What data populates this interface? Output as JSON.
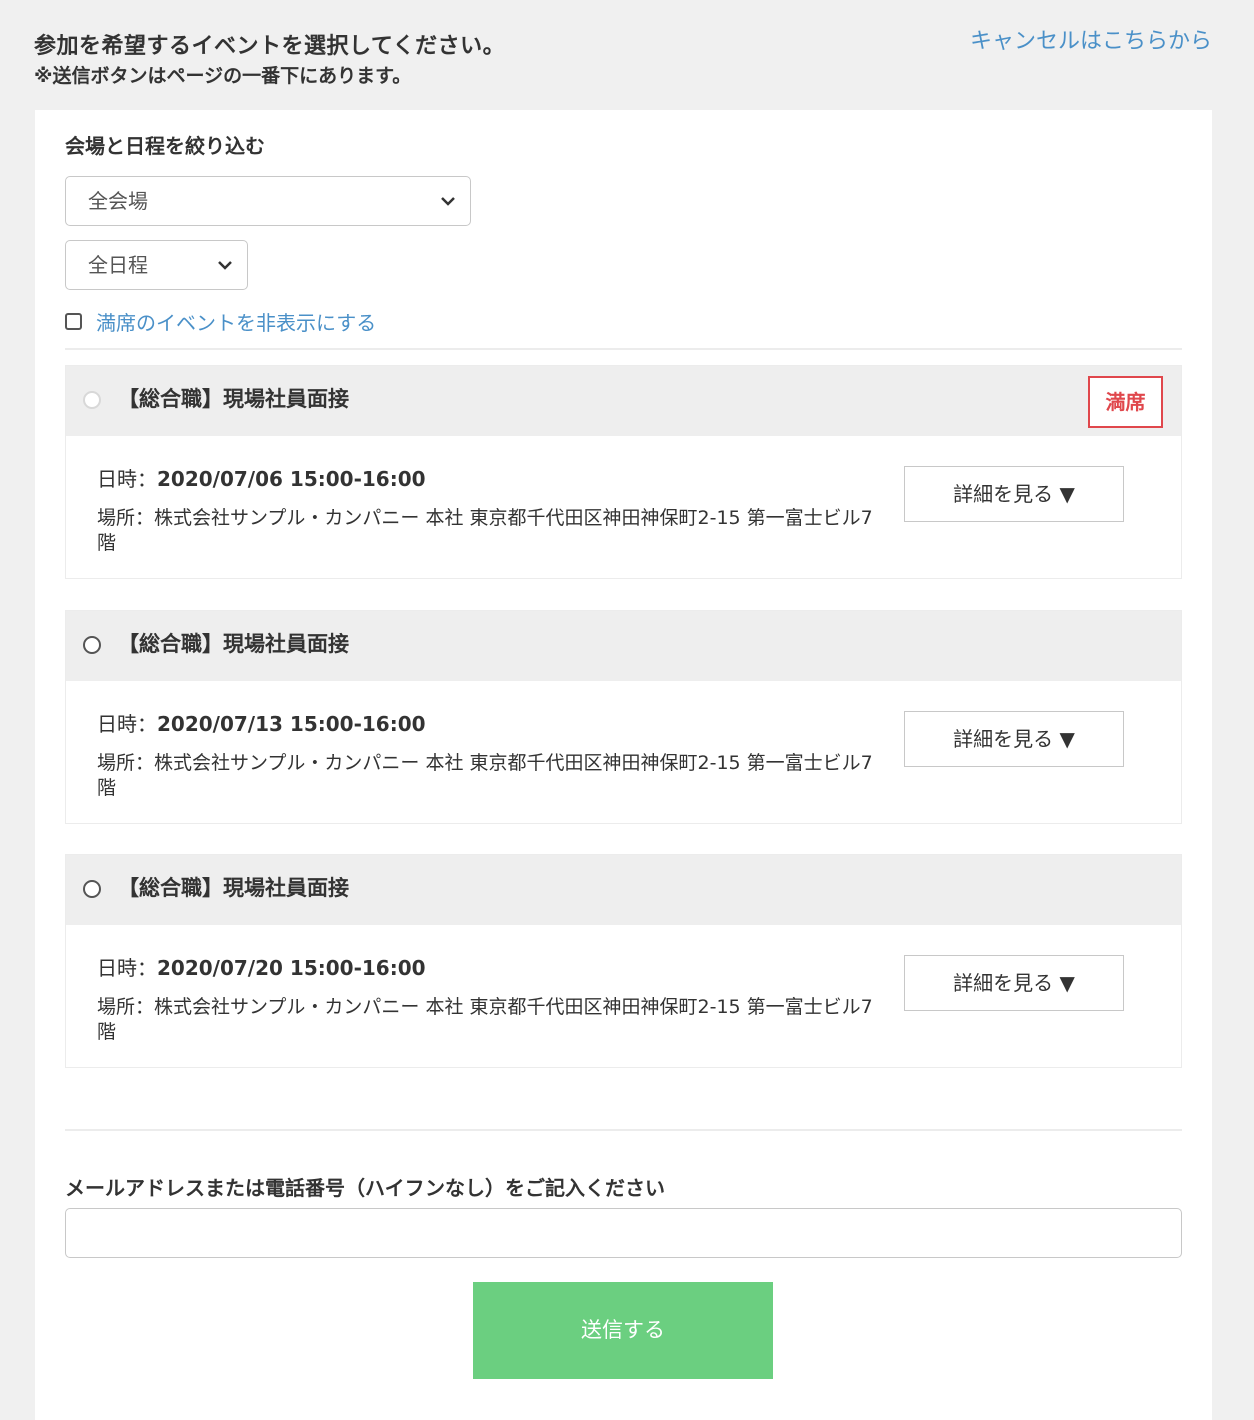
{
  "header": {
    "title": "参加を希望するイベントを選択してください。",
    "note": "※送信ボタンはページの一番下にあります。",
    "cancel_link": "キャンセルはこちらから"
  },
  "filter": {
    "label": "会場と日程を絞り込む",
    "venue_selected": "全会場",
    "date_selected": "全日程",
    "hide_full_label": "満席のイベントを非表示にする",
    "hide_full_checked": false
  },
  "events": [
    {
      "title": "【総合職】現場社員面接",
      "date_label": "日時：",
      "date_value": "2020/07/06 15:00-16:00",
      "place": "場所：株式会社サンプル・カンパニー 本社 東京都千代田区神田神保町2-15 第一富士ビル7階",
      "details_button": "詳細を見る ▼",
      "full_badge": "満席",
      "is_full": true
    },
    {
      "title": "【総合職】現場社員面接",
      "date_label": "日時：",
      "date_value": "2020/07/13 15:00-16:00",
      "place": "場所：株式会社サンプル・カンパニー 本社 東京都千代田区神田神保町2-15 第一富士ビル7階",
      "details_button": "詳細を見る ▼",
      "is_full": false
    },
    {
      "title": "【総合職】現場社員面接",
      "date_label": "日時：",
      "date_value": "2020/07/20 15:00-16:00",
      "place": "場所：株式会社サンプル・カンパニー 本社 東京都千代田区神田神保町2-15 第一富士ビル7階",
      "details_button": "詳細を見る ▼",
      "is_full": false
    }
  ],
  "contact": {
    "label": "メールアドレスまたは電話番号（ハイフンなし）をご記入ください",
    "value": ""
  },
  "submit": {
    "label": "送信する"
  },
  "colors": {
    "link": "#4a90c8",
    "full_badge": "#e0474c",
    "submit_bg": "#6bcf80",
    "page_bg": "#f0f0f0"
  }
}
